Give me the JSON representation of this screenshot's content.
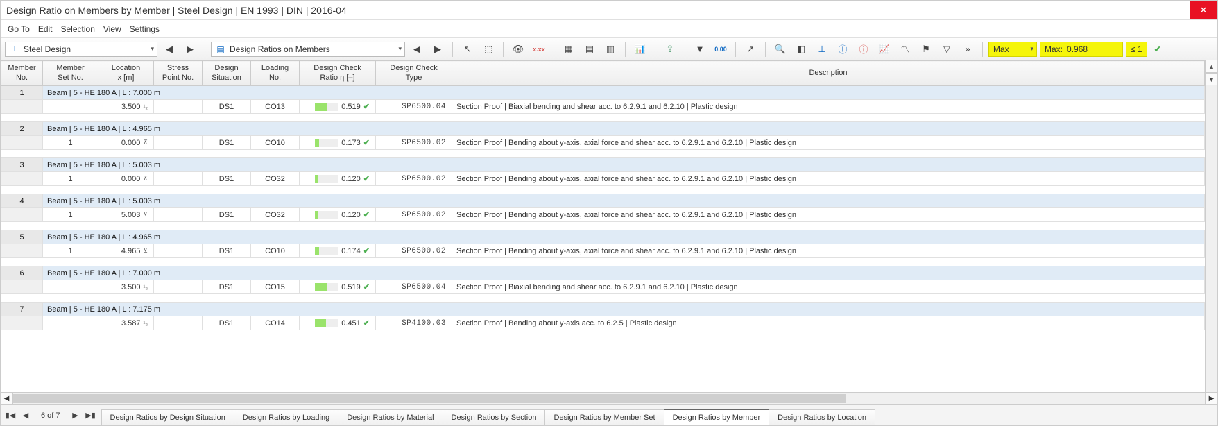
{
  "title": "Design Ratio on Members by Member | Steel Design | EN 1993 | DIN | 2016-04",
  "menu": {
    "items": [
      "Go To",
      "Edit",
      "Selection",
      "View",
      "Settings"
    ]
  },
  "toolbar": {
    "designModule": "Steel Design",
    "viewSelector": "Design Ratios on Members",
    "filterMode": "Max",
    "maxLabel": "Max:",
    "maxValue": "0.968",
    "limitLabel": "≤ 1"
  },
  "columns": [
    {
      "l1": "Member",
      "l2": "No."
    },
    {
      "l1": "Member",
      "l2": "Set No."
    },
    {
      "l1": "Location",
      "l2": "x [m]"
    },
    {
      "l1": "Stress",
      "l2": "Point No."
    },
    {
      "l1": "Design",
      "l2": "Situation"
    },
    {
      "l1": "Loading",
      "l2": "No."
    },
    {
      "l1": "Design Check",
      "l2": "Ratio η [–]"
    },
    {
      "l1": "Design Check",
      "l2": "Type"
    },
    {
      "l1": "Description",
      "l2": ""
    }
  ],
  "rows": [
    {
      "n": "1",
      "group": "Beam | 5 - HE 180 A | L : 7.000 m",
      "set": "",
      "loc": "3.500",
      "locSym": "¹₂",
      "sp": "",
      "ds": "DS1",
      "ld": "CO13",
      "ratio": "0.519",
      "bar": 0.52,
      "type": "SP6500.04",
      "desc": "Section Proof | Biaxial bending and shear acc. to 6.2.9.1 and 6.2.10 | Plastic design"
    },
    {
      "n": "2",
      "group": "Beam | 5 - HE 180 A | L : 4.965 m",
      "set": "1",
      "loc": "0.000",
      "locSym": "⊼",
      "sp": "",
      "ds": "DS1",
      "ld": "CO10",
      "ratio": "0.173",
      "bar": 0.17,
      "type": "SP6500.02",
      "desc": "Section Proof | Bending about y-axis, axial force and shear acc. to 6.2.9.1 and 6.2.10 | Plastic design"
    },
    {
      "n": "3",
      "group": "Beam | 5 - HE 180 A | L : 5.003 m",
      "set": "1",
      "loc": "0.000",
      "locSym": "⊼",
      "sp": "",
      "ds": "DS1",
      "ld": "CO32",
      "ratio": "0.120",
      "bar": 0.12,
      "type": "SP6500.02",
      "desc": "Section Proof | Bending about y-axis, axial force and shear acc. to 6.2.9.1 and 6.2.10 | Plastic design"
    },
    {
      "n": "4",
      "group": "Beam | 5 - HE 180 A | L : 5.003 m",
      "set": "1",
      "loc": "5.003",
      "locSym": "⊻",
      "sp": "",
      "ds": "DS1",
      "ld": "CO32",
      "ratio": "0.120",
      "bar": 0.12,
      "type": "SP6500.02",
      "desc": "Section Proof | Bending about y-axis, axial force and shear acc. to 6.2.9.1 and 6.2.10 | Plastic design"
    },
    {
      "n": "5",
      "group": "Beam | 5 - HE 180 A | L : 4.965 m",
      "set": "1",
      "loc": "4.965",
      "locSym": "⊻",
      "sp": "",
      "ds": "DS1",
      "ld": "CO10",
      "ratio": "0.174",
      "bar": 0.17,
      "type": "SP6500.02",
      "desc": "Section Proof | Bending about y-axis, axial force and shear acc. to 6.2.9.1 and 6.2.10 | Plastic design"
    },
    {
      "n": "6",
      "group": "Beam | 5 - HE 180 A | L : 7.000 m",
      "set": "",
      "loc": "3.500",
      "locSym": "¹₂",
      "sp": "",
      "ds": "DS1",
      "ld": "CO15",
      "ratio": "0.519",
      "bar": 0.52,
      "type": "SP6500.04",
      "desc": "Section Proof | Biaxial bending and shear acc. to 6.2.9.1 and 6.2.10 | Plastic design"
    },
    {
      "n": "7",
      "group": "Beam | 5 - HE 180 A | L : 7.175 m",
      "set": "",
      "loc": "3.587",
      "locSym": "¹₂",
      "sp": "",
      "ds": "DS1",
      "ld": "CO14",
      "ratio": "0.451",
      "bar": 0.45,
      "type": "SP4100.03",
      "desc": "Section Proof | Bending about y-axis acc. to 6.2.5 | Plastic design"
    }
  ],
  "footer": {
    "page": "6 of 7",
    "tabs": [
      "Design Ratios by Design Situation",
      "Design Ratios by Loading",
      "Design Ratios by Material",
      "Design Ratios by Section",
      "Design Ratios by Member Set",
      "Design Ratios by Member",
      "Design Ratios by Location"
    ],
    "activeTab": 5
  }
}
